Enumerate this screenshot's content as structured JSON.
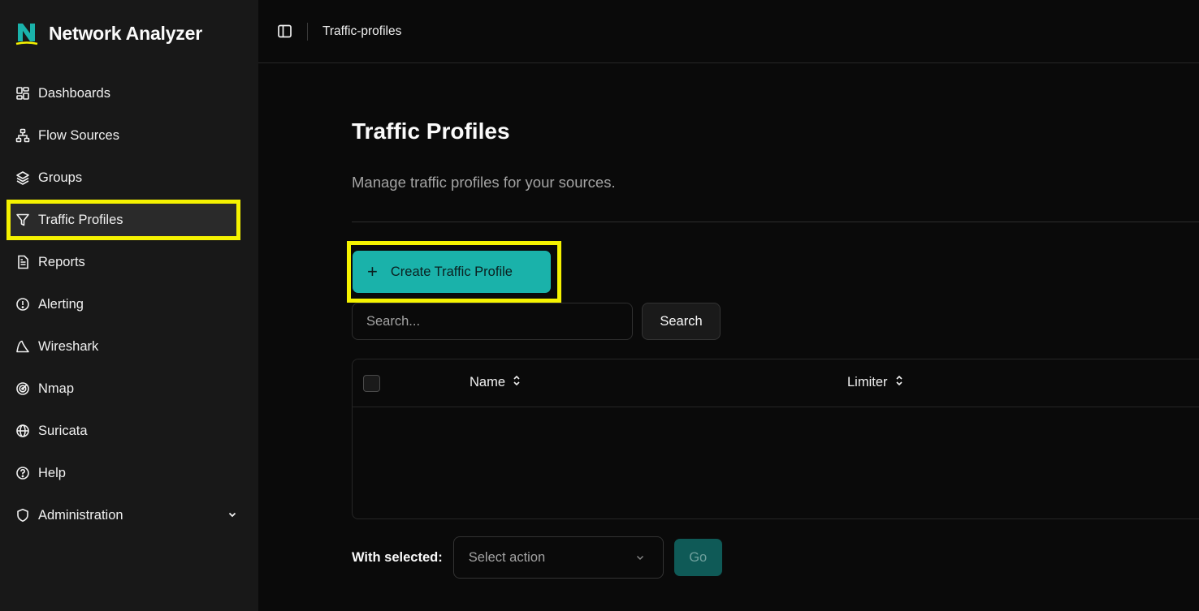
{
  "app": {
    "title": "Network Analyzer",
    "accent": "#1ab2aa",
    "highlight": "#f5f200"
  },
  "sidebar": {
    "items": [
      {
        "label": "Dashboards",
        "icon": "dashboard-icon"
      },
      {
        "label": "Flow Sources",
        "icon": "network-icon"
      },
      {
        "label": "Groups",
        "icon": "layers-icon"
      },
      {
        "label": "Traffic Profiles",
        "icon": "filter-icon",
        "active": true
      },
      {
        "label": "Reports",
        "icon": "file-text-icon"
      },
      {
        "label": "Alerting",
        "icon": "alert-circle-icon"
      },
      {
        "label": "Wireshark",
        "icon": "shark-fin-icon"
      },
      {
        "label": "Nmap",
        "icon": "radar-icon"
      },
      {
        "label": "Suricata",
        "icon": "globe-icon"
      },
      {
        "label": "Help",
        "icon": "help-circle-icon"
      },
      {
        "label": "Administration",
        "icon": "shield-icon"
      }
    ]
  },
  "topbar": {
    "breadcrumb": "Traffic-profiles"
  },
  "main": {
    "title": "Traffic Profiles",
    "subtitle": "Manage traffic profiles for your sources.",
    "create_label": "Create Traffic Profile",
    "search_placeholder": "Search...",
    "search_button": "Search",
    "columns": [
      "Name",
      "Limiter"
    ],
    "with_selected_label": "With selected:",
    "select_action_placeholder": "Select action",
    "go_label": "Go"
  }
}
